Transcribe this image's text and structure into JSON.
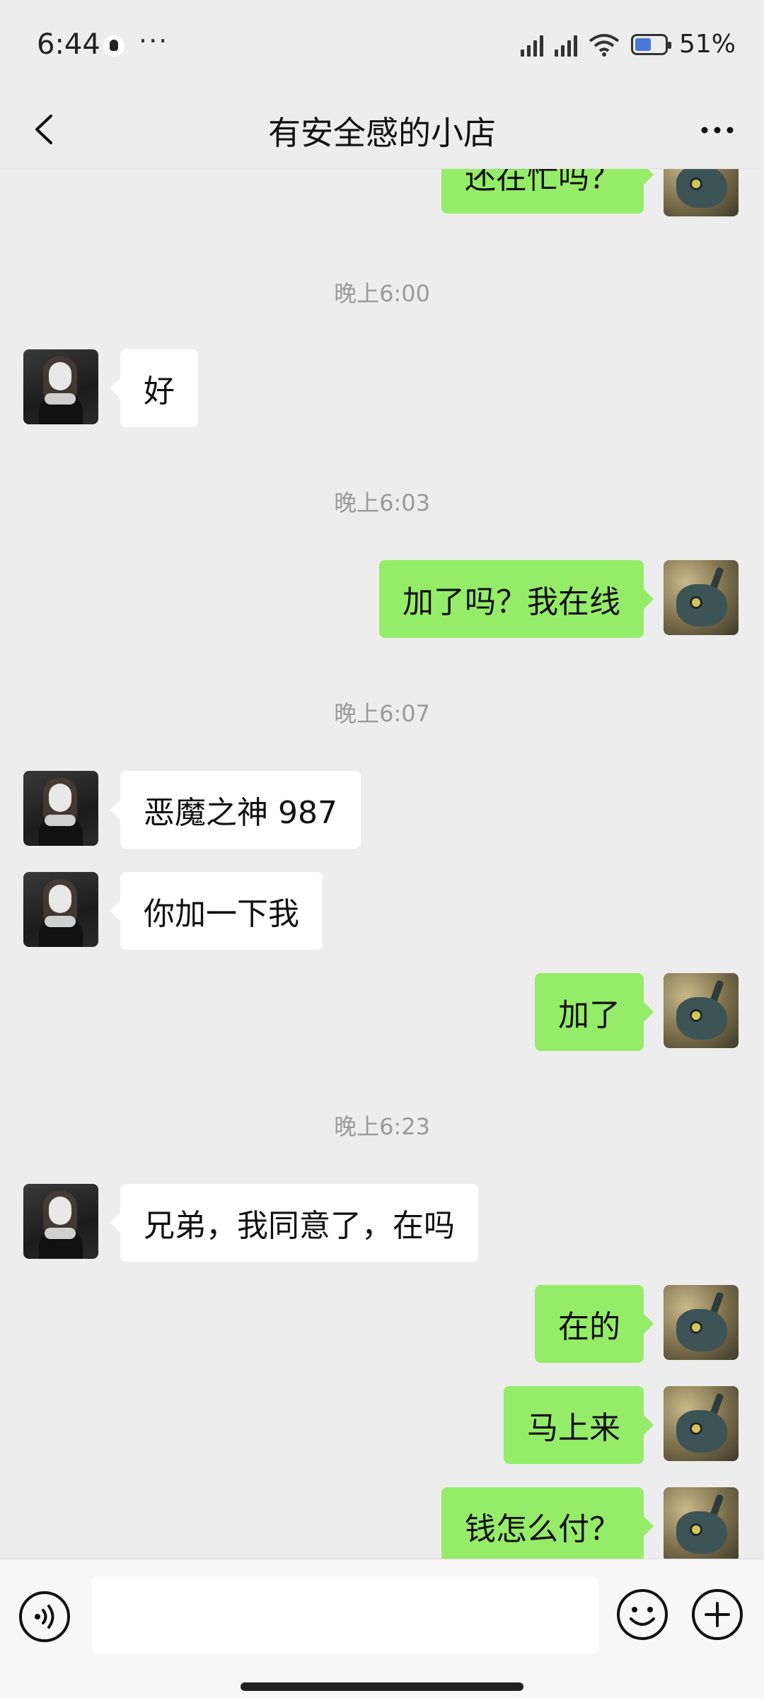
{
  "status_bar": {
    "time": "6:44",
    "notification_dots": "···",
    "battery_percent": "51%",
    "icons": [
      "qq-notification-icon",
      "signal-icon",
      "signal-icon",
      "wifi-icon",
      "battery-icon"
    ]
  },
  "header": {
    "title": "有安全感的小店",
    "back_icon": "chevron-left-icon",
    "more_icon": "more-horizontal-icon"
  },
  "messages": [
    {
      "type": "text",
      "side": "right",
      "text": "还在忙吗？"
    },
    {
      "type": "time",
      "text": "晚上6:00"
    },
    {
      "type": "text",
      "side": "left",
      "text": "好"
    },
    {
      "type": "time",
      "text": "晚上6:03"
    },
    {
      "type": "text",
      "side": "right",
      "text": "加了吗？我在线"
    },
    {
      "type": "time",
      "text": "晚上6:07"
    },
    {
      "type": "text",
      "side": "left",
      "text": "恶魔之神 987"
    },
    {
      "type": "text",
      "side": "left",
      "text": "你加一下我"
    },
    {
      "type": "text",
      "side": "right",
      "text": "加了"
    },
    {
      "type": "time",
      "text": "晚上6:23"
    },
    {
      "type": "text",
      "side": "left",
      "text": "兄弟，我同意了，在吗"
    },
    {
      "type": "text",
      "side": "right",
      "text": "在的"
    },
    {
      "type": "text",
      "side": "right",
      "text": "马上来"
    },
    {
      "type": "text",
      "side": "right",
      "text": "钱怎么付？"
    }
  ],
  "input_bar": {
    "field_value": "",
    "voice_icon": "voice-input-icon",
    "emoji_icon": "emoji-icon",
    "plus_icon": "plus-icon"
  },
  "colors": {
    "background": "#ededed",
    "my_bubble": "#95ec69",
    "their_bubble": "#ffffff",
    "timestamp": "#9a9a9a"
  }
}
